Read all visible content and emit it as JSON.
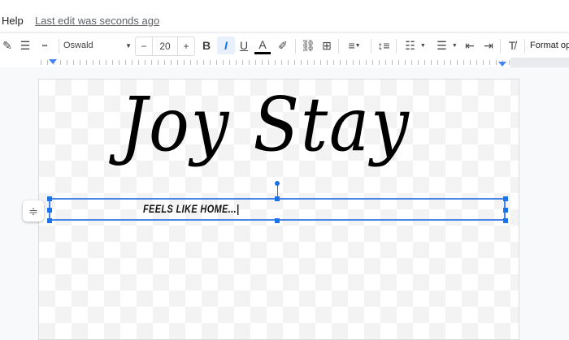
{
  "menu": {
    "help": "Help",
    "last_edit": "Last edit was seconds ago"
  },
  "toolbar": {
    "font": "Oswald",
    "font_size": "20",
    "minus": "−",
    "plus": "+",
    "bold": "B",
    "italic": "I",
    "underline": "U",
    "text_color": "A",
    "format_options": "Format op",
    "text_color_value": "#000000"
  },
  "canvas": {
    "title": "Joy Stay",
    "subtitle": "FEELS LIKE HOME...|"
  },
  "colors": {
    "accent": "#1a73e8",
    "active_bg": "#e8f0fe"
  }
}
